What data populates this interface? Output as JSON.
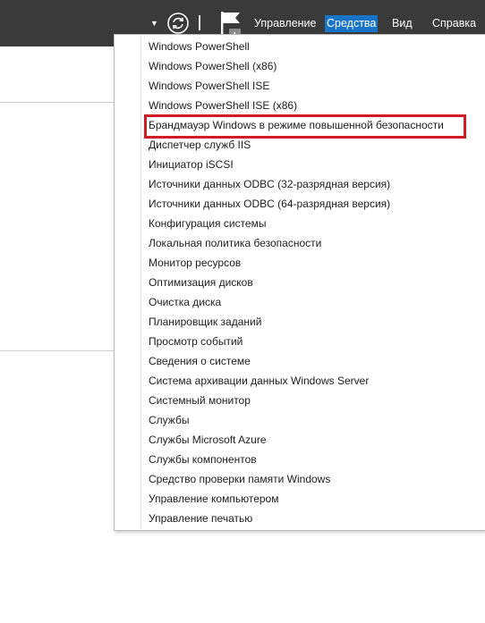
{
  "toolbar": {
    "notification_count": "1",
    "menu": {
      "manage": "Управление",
      "tools": "Средства",
      "view": "Вид",
      "help": "Справка"
    },
    "icons": {
      "dropdown": "caret-down-icon",
      "refresh": "refresh-icon",
      "notifications": "flag-icon"
    },
    "accent_color": "#1874c6"
  },
  "tools_menu": {
    "items": [
      "Windows PowerShell",
      "Windows PowerShell (x86)",
      "Windows PowerShell ISE",
      "Windows PowerShell ISE (x86)",
      "Брандмауэр Windows в режиме повышенной безопасности",
      "Диспетчер служб IIS",
      "Инициатор iSCSI",
      "Источники данных ODBC (32-разрядная версия)",
      "Источники данных ODBC (64-разрядная версия)",
      "Конфигурация системы",
      "Локальная политика безопасности",
      "Монитор ресурсов",
      "Оптимизация дисков",
      "Очистка диска",
      "Планировщик заданий",
      "Просмотр событий",
      "Сведения о системе",
      "Система архивации данных Windows Server",
      "Системный монитор",
      "Службы",
      "Службы Microsoft Azure",
      "Службы компонентов",
      "Средство проверки памяти Windows",
      "Управление компьютером",
      "Управление печатью"
    ],
    "highlight_color": "#d01d25"
  }
}
